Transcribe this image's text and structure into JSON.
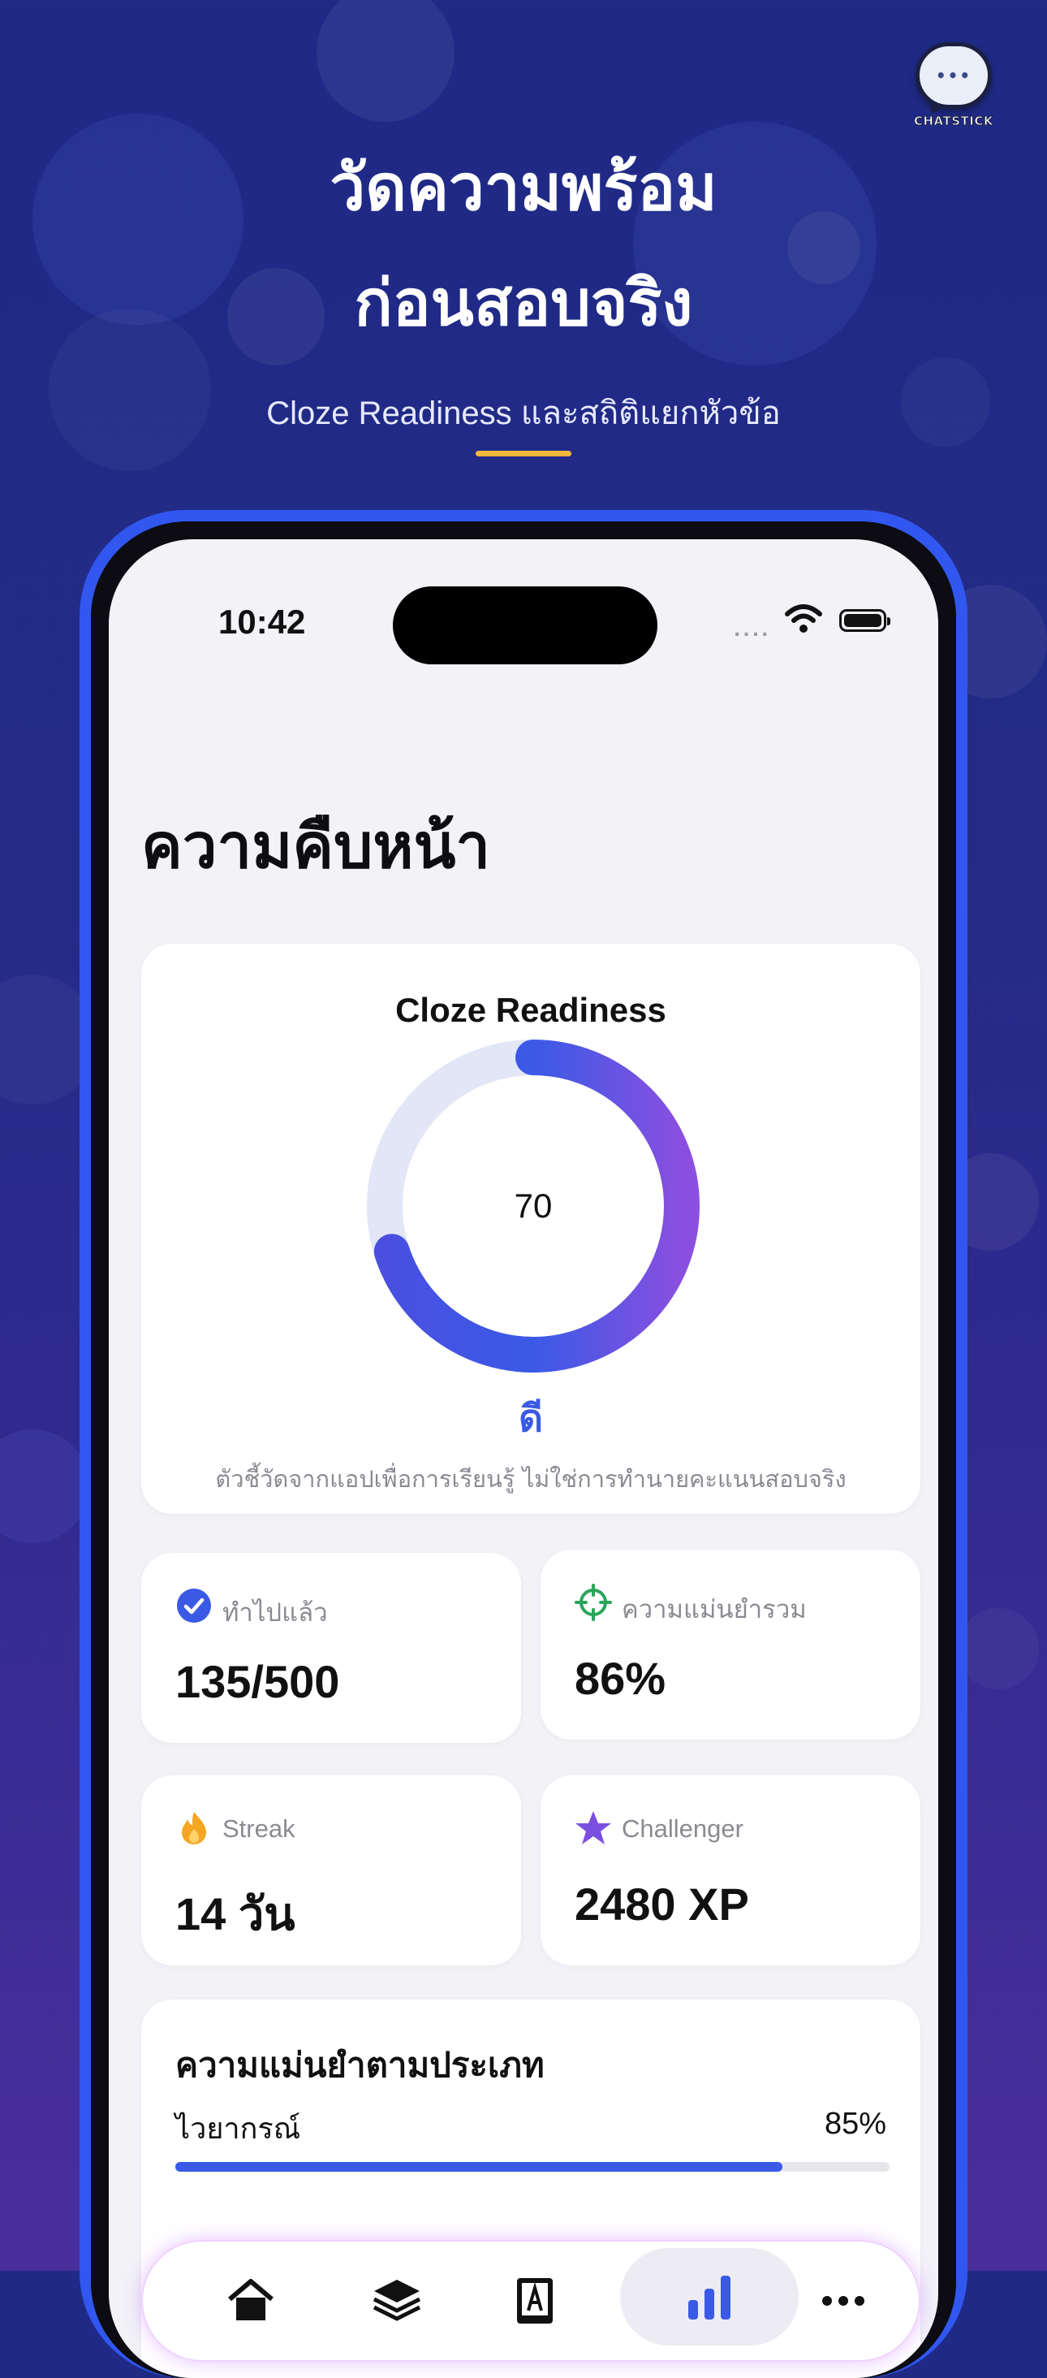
{
  "promo": {
    "headline_line1": "วัดความพร้อม",
    "headline_line2": "ก่อนสอบจริง",
    "subheadline": "Cloze Readiness และสถิติแยกหัวข้อ",
    "logo_text": "CHATSTICK",
    "accent_color": "#f6b73c"
  },
  "status_bar": {
    "time": "10:42",
    "signal": "....",
    "icons": [
      "wifi-icon",
      "battery-icon"
    ]
  },
  "screen": {
    "title": "ความคืบหน้า"
  },
  "readiness": {
    "title": "Cloze Readiness",
    "value": "70",
    "score": 70,
    "max": 100,
    "level": "ดี",
    "note": "ตัวชี้วัดจากแอปเพื่อการเรียนรู้ ไม่ใช่การทำนายคะแนนสอบจริง",
    "ring_colors": [
      "#3a5ae6",
      "#8a4fe0"
    ]
  },
  "stats": [
    {
      "icon": "check-circle-icon",
      "label": "ทำไปแล้ว",
      "value": "135/500",
      "color": "#3a5ae6"
    },
    {
      "icon": "target-icon",
      "label": "ความแม่นยำรวม",
      "value": "86%",
      "color": "#2aa55a"
    },
    {
      "icon": "flame-icon",
      "label": "Streak",
      "value": "14 วัน",
      "color": "#f5a623"
    },
    {
      "icon": "star-icon",
      "label": "Challenger",
      "value": "2480 XP",
      "color": "#7a4fe0"
    }
  ],
  "accuracy_by_type": {
    "title": "ความแม่นยำตามประเภท",
    "rows": [
      {
        "label": "ไวยากรณ์",
        "value": "85%",
        "fraction": 0.85
      }
    ]
  },
  "tabbar": {
    "tabs": [
      {
        "icon": "home-icon"
      },
      {
        "icon": "layers-icon"
      },
      {
        "icon": "dictionary-icon"
      },
      {
        "icon": "chart-icon",
        "active": true
      },
      {
        "icon": "more-icon"
      }
    ]
  }
}
